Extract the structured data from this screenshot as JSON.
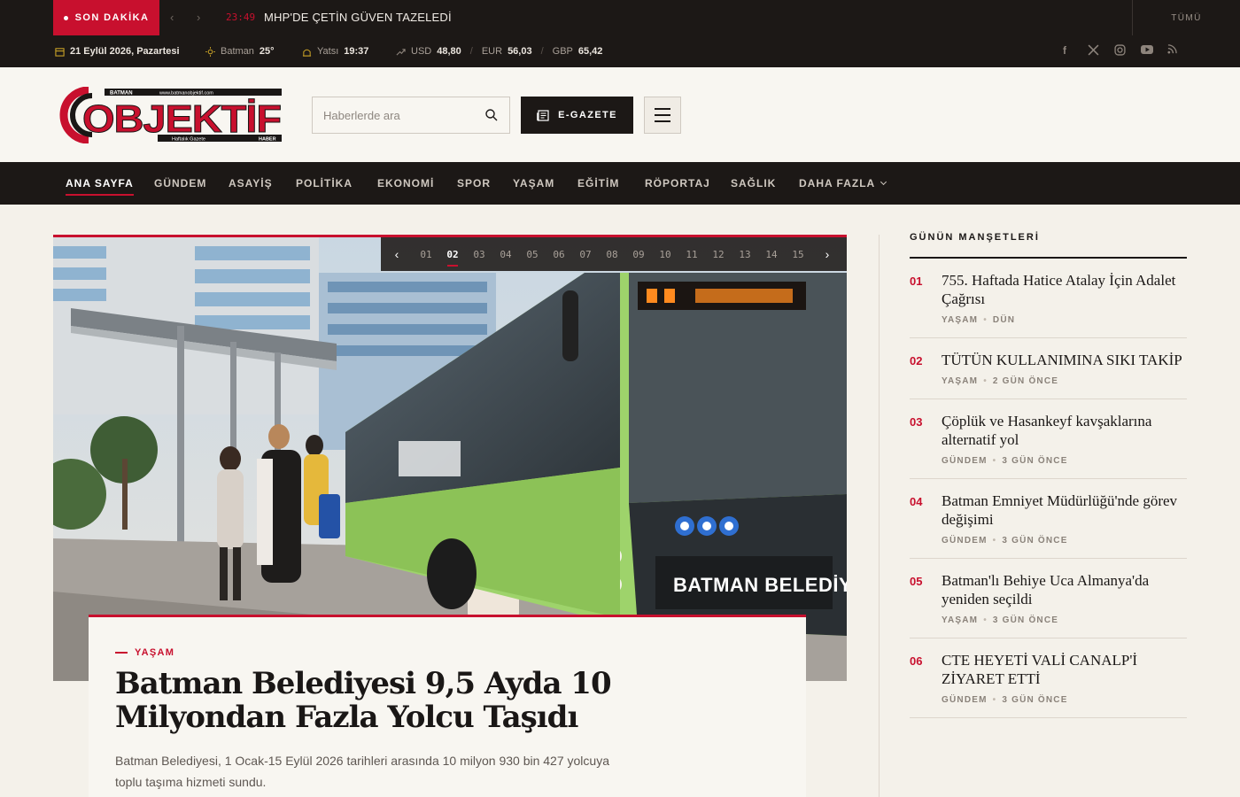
{
  "breaking": {
    "badge": "SON DAKİKA",
    "time": "23:49",
    "text": "MHP'DE ÇETİN GÜVEN TAZELEDİ",
    "all_label": "TÜMÜ"
  },
  "info": {
    "date": "21 Eylül 2026, Pazartesi",
    "city": "Batman",
    "temp": "25°",
    "prayer_label": "Yatsı",
    "prayer_time": "19:37",
    "usd_label": "USD",
    "usd": "48,80",
    "eur_label": "EUR",
    "eur": "56,03",
    "gbp_label": "GBP",
    "gbp": "65,42"
  },
  "header": {
    "logo_main": "OBJEKTİF",
    "logo_top_left": "BATMAN",
    "logo_top_right": "www.batmanobjektif.com",
    "logo_bottom_left": "Haftalık Gazete",
    "logo_bottom_right": "HABER",
    "search_placeholder": "Haberlerde ara",
    "egazete_label": "E-GAZETE"
  },
  "nav": {
    "items": [
      "ANA SAYFA",
      "GÜNDEM",
      "ASAYİŞ",
      "POLİTİKA",
      "EKONOMİ",
      "SPOR",
      "YAŞAM",
      "EĞİTİM",
      "RÖPORTAJ",
      "SAĞLIK",
      "DAHA FAZLA"
    ]
  },
  "hero": {
    "pager": [
      "01",
      "02",
      "03",
      "04",
      "05",
      "06",
      "07",
      "08",
      "09",
      "10",
      "11",
      "12",
      "13",
      "14",
      "15"
    ],
    "active_page": "02",
    "bus_sign": "BATMAN BELEDİYESİ",
    "category": "YAŞAM",
    "title": "Batman Belediyesi 9,5 Ayda 10 Milyondan Fazla Yolcu Taşıdı",
    "description": "Batman Belediyesi, 1 Ocak-15 Eylül 2026 tarihleri arasında 10 milyon 930 bin 427 yolcuya toplu taşıma hizmeti sundu."
  },
  "sidebar": {
    "title": "GÜNÜN MANŞETLERİ",
    "items": [
      {
        "num": "01",
        "title": "755. Haftada Hatice Atalay İçin Adalet Çağrısı",
        "category": "YAŞAM",
        "time": "DÜN"
      },
      {
        "num": "02",
        "title": "TÜTÜN KULLANIMINA SIKI TAKİP",
        "category": "YAŞAM",
        "time": "2 GÜN ÖNCE"
      },
      {
        "num": "03",
        "title": "Çöplük ve Hasankeyf kavşaklarına alternatif yol",
        "category": "GÜNDEM",
        "time": "3 GÜN ÖNCE"
      },
      {
        "num": "04",
        "title": "Batman Emniyet Müdürlüğü'nde görev değişimi",
        "category": "GÜNDEM",
        "time": "3 GÜN ÖNCE"
      },
      {
        "num": "05",
        "title": "Batman'lı Behiye Uca Almanya'da yeniden seçildi",
        "category": "YAŞAM",
        "time": "3 GÜN ÖNCE"
      },
      {
        "num": "06",
        "title": "CTE HEYETİ VALİ CANALP'İ ZİYARET ETTİ",
        "category": "GÜNDEM",
        "time": "3 GÜN ÖNCE"
      }
    ]
  },
  "colors": {
    "accent": "#c8102e",
    "dark": "#1c1816",
    "paper": "#f4f1ea",
    "bus_green": "#7cc242"
  }
}
